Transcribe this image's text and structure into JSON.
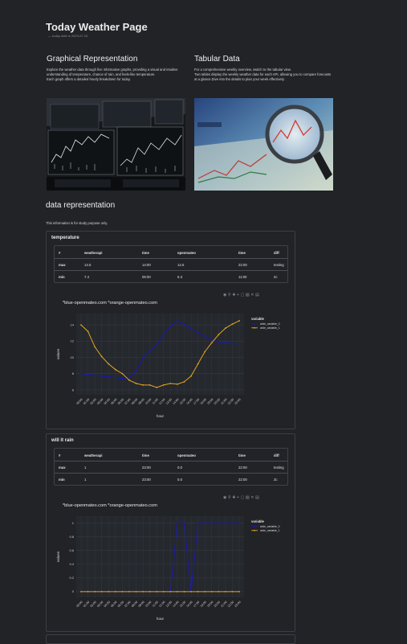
{
  "page": {
    "title": "Today Weather Page",
    "subtitle": "— today date is 2023-07-10"
  },
  "graphical": {
    "heading": "Graphical Representation",
    "text": "Explore the weather data through five informative graphs, providing a visual and intuitive understanding of temperature, chance of rain, and feels-like temperature.\nEach graph offers a detailed hourly breakdown for today."
  },
  "tabular": {
    "heading": "Tabular Data",
    "text": "For a comprehensive weekly overview, switch to the tabular view.\nTwo tables display the weekly weather data for each API, allowing you to compare forecasts at a glance.Dive into the details to plan your week effectively."
  },
  "data_representation": {
    "heading": "data representation",
    "note": "This information is for study purpose only."
  },
  "table_headers": [
    "#",
    "weatherapi",
    "time",
    "openmateo",
    "time",
    "diff"
  ],
  "toolbar_icons": [
    "camera-icon",
    "zoom-icon",
    "pan-icon",
    "zoom-in-icon",
    "zoom-out-icon",
    "autoscale-icon",
    "reset-axes-icon",
    "logo-icon"
  ],
  "panels": [
    {
      "title": "temperature",
      "rows": [
        {
          "label": "max",
          "weatherapi": "14.5",
          "time1": "14:00",
          "openmateo": "14.5",
          "time2": "22:00",
          "diff": "testing"
        },
        {
          "label": "min",
          "weatherapi": "7.4",
          "time1": "06:00",
          "openmateo": "6.3",
          "time2": "11:00",
          "diff": "2c"
        }
      ]
    },
    {
      "title": "will it rain",
      "rows": [
        {
          "label": "max",
          "weatherapi": "1",
          "time1": "23:00",
          "openmateo": "0.0",
          "time2": "22:00",
          "diff": "testing"
        },
        {
          "label": "min",
          "weatherapi": "1",
          "time1": "23:00",
          "openmateo": "0.0",
          "time2": "22:00",
          "diff": "2c"
        }
      ]
    }
  ],
  "chart_data": [
    {
      "type": "line",
      "title": "*blue-openmateo.com *orange-openmateo.com",
      "xlabel": "hour",
      "ylabel": "values",
      "legend_title": "variable",
      "legend_position": "top-right",
      "grid": true,
      "x": [
        "00:00",
        "01:00",
        "02:00",
        "03:00",
        "04:00",
        "05:00",
        "06:00",
        "07:00",
        "08:00",
        "09:00",
        "10:00",
        "11:00",
        "12:00",
        "13:00",
        "14:00",
        "15:00",
        "16:00",
        "17:00",
        "18:00",
        "19:00",
        "20:00",
        "21:00",
        "22:00",
        "23:00"
      ],
      "yticks": [
        6,
        8,
        10,
        12,
        14
      ],
      "ylim": [
        5.6,
        15.2
      ],
      "series": [
        {
          "name": "wide_variable_0",
          "color": "#1a1ab0",
          "values": [
            8.0,
            7.9,
            7.8,
            7.7,
            7.6,
            7.5,
            7.4,
            7.5,
            8.4,
            9.9,
            10.8,
            11.5,
            12.8,
            13.9,
            14.5,
            14.1,
            13.5,
            13.1,
            12.6,
            12.2,
            11.9,
            11.8,
            11.7,
            11.7
          ]
        },
        {
          "name": "wide_variable_1",
          "color": "#e3a520",
          "values": [
            14.0,
            13.2,
            11.3,
            10.1,
            9.2,
            8.5,
            8.0,
            7.2,
            6.8,
            6.6,
            6.6,
            6.3,
            6.6,
            6.8,
            6.7,
            7.0,
            7.7,
            9.2,
            10.7,
            11.8,
            12.8,
            13.6,
            14.1,
            14.5
          ]
        }
      ]
    },
    {
      "type": "line",
      "title": "*blue-openmateo.com *orange-openmateo.com",
      "xlabel": "hour",
      "ylabel": "values",
      "legend_title": "variable",
      "legend_position": "top-right",
      "grid": true,
      "x": [
        "00:00",
        "01:00",
        "02:00",
        "03:00",
        "04:00",
        "05:00",
        "06:00",
        "07:00",
        "08:00",
        "09:00",
        "10:00",
        "11:00",
        "12:00",
        "13:00",
        "14:00",
        "15:00",
        "16:00",
        "17:00",
        "18:00",
        "19:00",
        "20:00",
        "21:00",
        "22:00",
        "23:00"
      ],
      "yticks": [
        0,
        0.2,
        0.4,
        0.6,
        0.8,
        1
      ],
      "ylim": [
        -0.06,
        1.08
      ],
      "series": [
        {
          "name": "wide_variable_0",
          "color": "#1a1ab0",
          "values": [
            0,
            0,
            0,
            0,
            0,
            0,
            0,
            0,
            0,
            0,
            0,
            0,
            0,
            0,
            1,
            1,
            0,
            1,
            1,
            1,
            1,
            1,
            1,
            1
          ]
        },
        {
          "name": "wide_variable_1",
          "color": "#e3a520",
          "values": [
            0,
            0,
            0,
            0,
            0,
            0,
            0,
            0,
            0,
            0,
            0,
            0,
            0,
            0,
            0,
            0,
            0,
            0,
            0,
            0,
            0,
            0,
            0,
            0
          ]
        }
      ]
    }
  ]
}
